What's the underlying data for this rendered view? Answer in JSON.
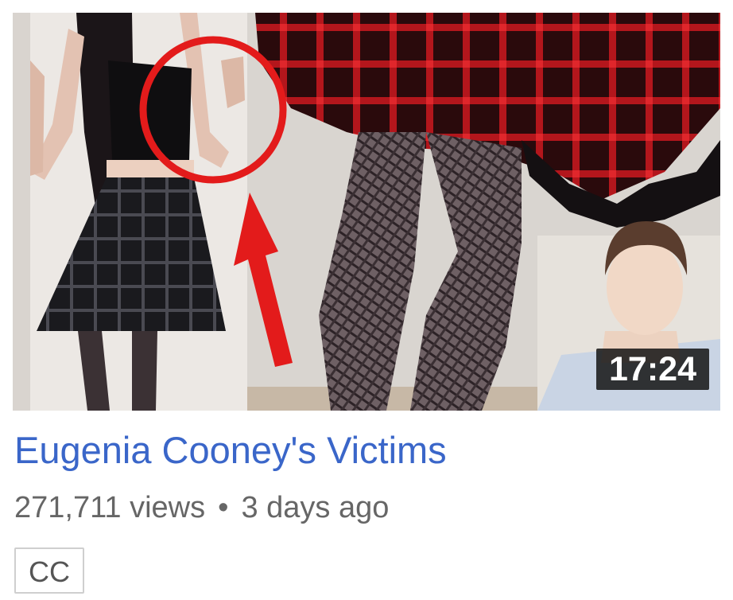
{
  "video": {
    "title": "Eugenia Cooney's Victims",
    "duration": "17:24",
    "views": "271,711 views",
    "separator": "•",
    "age": "3 days ago",
    "badge": "CC"
  },
  "colors": {
    "title": "#3a66c9",
    "meta": "#666666",
    "annotation": "#e31b1b"
  }
}
